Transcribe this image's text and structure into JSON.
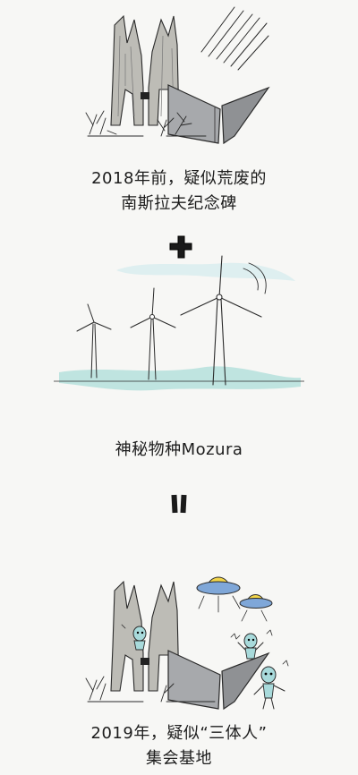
{
  "section1": {
    "line1": "2018年前，疑似荒废的",
    "line2": "南斯拉夫纪念碑"
  },
  "operator_plus": "+",
  "section2": {
    "caption": "神秘物种Mozura"
  },
  "operator_equals": "=",
  "section3": {
    "line1": "2019年，疑似“三体人”",
    "line2": "集会基地"
  },
  "colors": {
    "background": "#f7f7f5",
    "stone": "#b9b8b3",
    "metal": "#9a9c9f",
    "water": "#a9d8d4",
    "ufo_dome": "#f2d54a",
    "ufo_body": "#7fa7d8",
    "alien": "#a8dadb"
  }
}
